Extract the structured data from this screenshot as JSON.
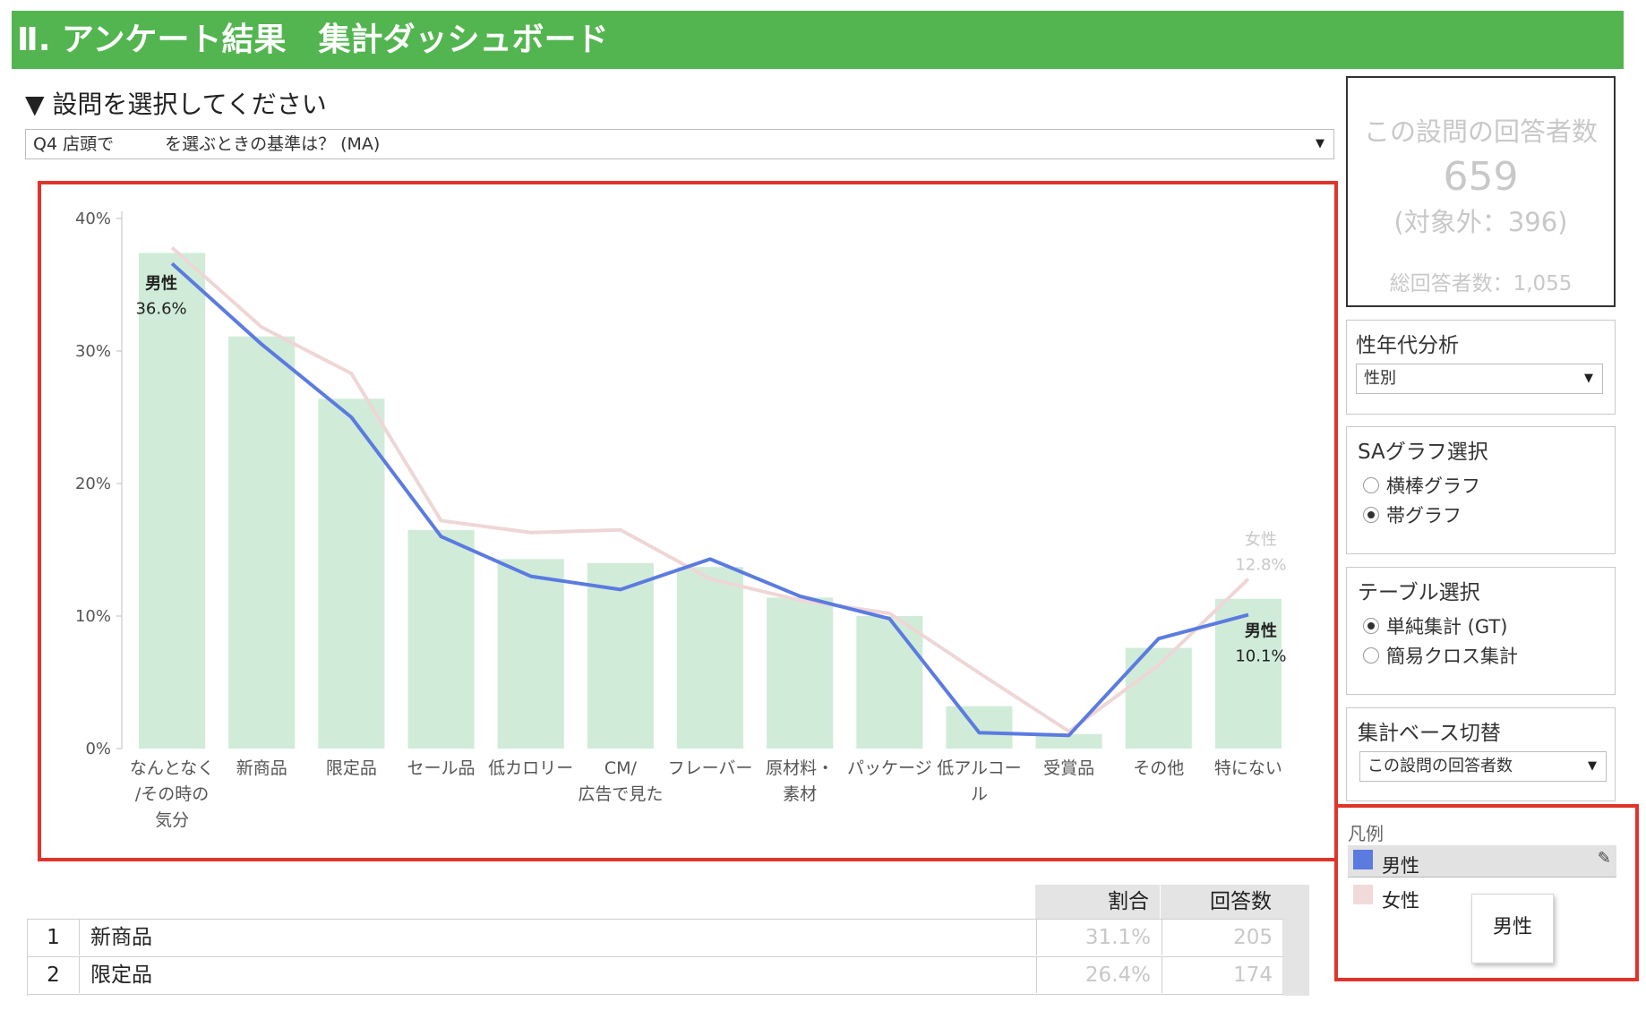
{
  "header": {
    "title": "Ⅱ. アンケート結果　集計ダッシュボード"
  },
  "question": {
    "prompt": "▼ 設問を選択してください",
    "selected": "Q4 店頭で　　　を選ぶときの基準は？ (MA)"
  },
  "respondents": {
    "title": "この設問の回答者数",
    "count": "659",
    "excluded": "(対象外：396)",
    "total": "総回答者数：1,055"
  },
  "filters": {
    "demographic": {
      "title": "性年代分析",
      "value": "性別"
    },
    "sa_graph": {
      "title": "SAグラフ選択",
      "options": [
        {
          "label": "横棒グラフ",
          "selected": false
        },
        {
          "label": "帯グラフ",
          "selected": true
        }
      ]
    },
    "table_select": {
      "title": "テーブル選択",
      "options": [
        {
          "label": "単純集計 (GT)",
          "selected": true
        },
        {
          "label": "簡易クロス集計",
          "selected": false
        }
      ]
    },
    "base": {
      "title": "集計ベース切替",
      "value": "この設問の回答者数"
    }
  },
  "legend": {
    "title": "凡例",
    "items": [
      {
        "label": "男性",
        "color": "#5b7be0"
      },
      {
        "label": "女性",
        "color": "#f0dada"
      }
    ],
    "tooltip": "男性"
  },
  "table": {
    "headers": {
      "ratio": "割合",
      "count": "回答数"
    },
    "rows": [
      {
        "rank": "1",
        "label": "新商品",
        "ratio": "31.1%",
        "count": "205"
      },
      {
        "rank": "2",
        "label": "限定品",
        "ratio": "26.4%",
        "count": "174"
      }
    ]
  },
  "chart_data": {
    "type": "bar",
    "categories": [
      "なんとなく\n/その時の\n気分",
      "新商品",
      "限定品",
      "セール品",
      "低カロリー",
      "CM/\n広告で見た",
      "フレーバー",
      "原材料・\n素材",
      "パッケージ",
      "低アルコー\nル",
      "受賞品",
      "その他",
      "特にない"
    ],
    "ylim": [
      0,
      40
    ],
    "yticks": [
      "0%",
      "10%",
      "20%",
      "30%",
      "40%"
    ],
    "ytick_values": [
      0,
      10,
      20,
      30,
      40
    ],
    "colors": {
      "bars": "#d0ecd8",
      "male": "#5b7be0",
      "female": "#efd6d6",
      "female_label": "#c8c8c8"
    },
    "series": [
      {
        "name": "",
        "type": "bar",
        "values": [
          37.4,
          31.1,
          26.4,
          16.5,
          14.3,
          14.0,
          13.7,
          11.4,
          10.0,
          3.2,
          1.1,
          7.6,
          11.3
        ]
      },
      {
        "name": "男性",
        "type": "line",
        "values": [
          36.6,
          30.5,
          25.0,
          16.0,
          13.0,
          12.0,
          14.3,
          11.5,
          9.8,
          1.2,
          1.0,
          8.3,
          10.1
        ]
      },
      {
        "name": "女性",
        "type": "line",
        "values": [
          37.8,
          31.8,
          28.3,
          17.2,
          16.3,
          16.5,
          12.8,
          11.2,
          10.2,
          5.7,
          1.3,
          6.3,
          12.8
        ]
      }
    ],
    "labels": {
      "male_start": {
        "name": "男性",
        "value": "36.6%"
      },
      "male_end": {
        "name": "男性",
        "value": "10.1%"
      },
      "female_end": {
        "name": "女性",
        "value": "12.8%"
      }
    }
  }
}
